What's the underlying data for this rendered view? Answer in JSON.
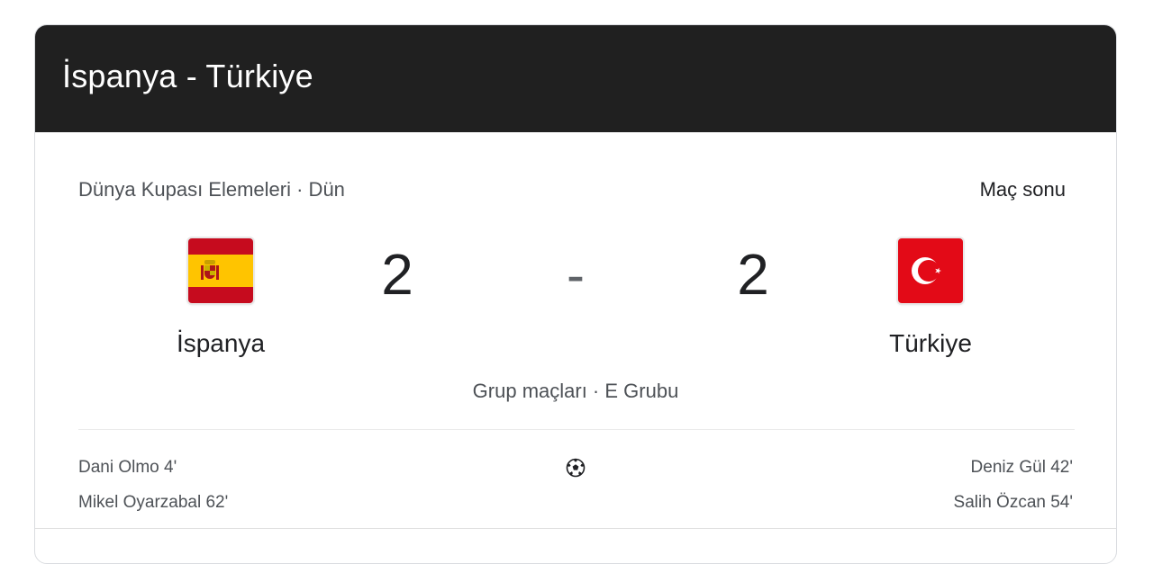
{
  "header": {
    "title": "İspanya - Türkiye"
  },
  "match": {
    "competition_line": "Dünya Kupası Elemeleri · Dün",
    "status": "Maç sonu",
    "stage": "Grup maçları · E Grubu",
    "score_separator": "-"
  },
  "home": {
    "name": "İspanya",
    "score": "2",
    "flag_icon": "spain-flag-icon",
    "scorers": [
      "Dani Olmo 4'",
      "Mikel Oyarzabal 62'"
    ]
  },
  "away": {
    "name": "Türkiye",
    "score": "2",
    "flag_icon": "turkey-flag-icon",
    "scorers": [
      "Deniz Gül 42'",
      "Salih Özcan 54'"
    ]
  },
  "icons": {
    "goal": "soccer-ball-icon"
  },
  "colors": {
    "header_bg": "#202020",
    "spain_red": "#c60b1e",
    "spain_yellow": "#ffc400",
    "turkey_red": "#e30a17"
  }
}
